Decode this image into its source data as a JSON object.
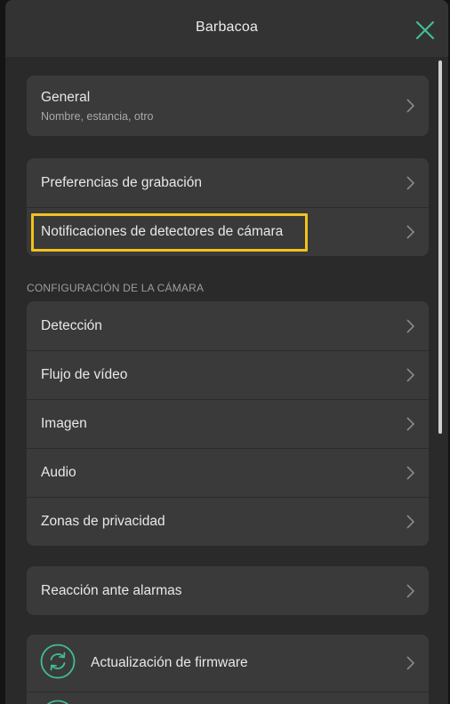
{
  "header": {
    "title": "Barbacoa",
    "close_icon": "close-icon",
    "accent_color": "#3fbf8f"
  },
  "groups": {
    "general": {
      "label": "General",
      "sublabel": "Nombre, estancia, otro"
    },
    "recording": {
      "preferences": "Preferencias de grabación",
      "notifications": "Notificaciones de detectores de cámara"
    },
    "camera_config": {
      "section_title": "CONFIGURACIÓN DE LA CÁMARA",
      "items": [
        "Detección",
        "Flujo de vídeo",
        "Imagen",
        "Audio",
        "Zonas de privacidad"
      ]
    },
    "alarms": {
      "label": "Reacción ante alarmas"
    },
    "firmware": {
      "label": "Actualización de firmware",
      "icon": "refresh-icon"
    }
  },
  "highlight_color": "#f2c21b"
}
